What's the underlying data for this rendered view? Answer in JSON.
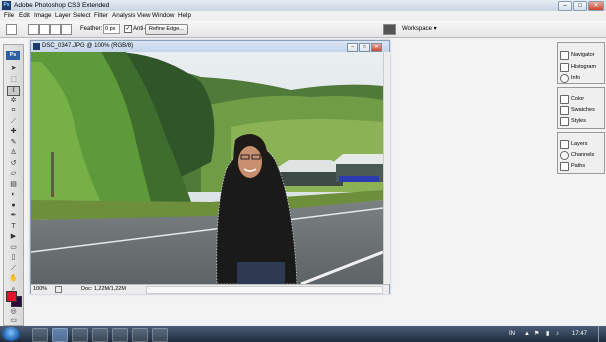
{
  "app": {
    "title": "Adobe Photoshop CS3 Extended",
    "logo_text": "Ps",
    "window_buttons": [
      "–",
      "□",
      "✕"
    ]
  },
  "menu": [
    "File",
    "Edit",
    "Image",
    "Layer",
    "Select",
    "Filter",
    "Analysis",
    "View",
    "Window",
    "Help"
  ],
  "options_bar": {
    "feather_label": "Feather:",
    "feather_value": "0 px",
    "antialias_label": "Anti-alias",
    "refine_edge_label": "Refine Edge...",
    "workspace_label": "Workspace ▾"
  },
  "toolbox": {
    "badge": "Ps",
    "tools": [
      {
        "name": "move-tool-icon",
        "glyph": "➤"
      },
      {
        "name": "marquee-tool-icon",
        "glyph": "⬚"
      },
      {
        "name": "lasso-tool-icon",
        "glyph": "ℓ",
        "selected": true
      },
      {
        "name": "magic-wand-icon",
        "glyph": "✲"
      },
      {
        "name": "crop-tool-icon",
        "glyph": "⌗"
      },
      {
        "name": "slice-tool-icon",
        "glyph": "⟋"
      },
      {
        "name": "healing-brush-icon",
        "glyph": "✚"
      },
      {
        "name": "brush-tool-icon",
        "glyph": "✎"
      },
      {
        "name": "clone-stamp-icon",
        "glyph": "♙"
      },
      {
        "name": "history-brush-icon",
        "glyph": "↺"
      },
      {
        "name": "eraser-tool-icon",
        "glyph": "▱"
      },
      {
        "name": "gradient-tool-icon",
        "glyph": "▤"
      },
      {
        "name": "blur-tool-icon",
        "glyph": "◐"
      },
      {
        "name": "dodge-tool-icon",
        "glyph": "●"
      },
      {
        "name": "pen-tool-icon",
        "glyph": "✒"
      },
      {
        "name": "type-tool-icon",
        "glyph": "T"
      },
      {
        "name": "path-select-icon",
        "glyph": "▶"
      },
      {
        "name": "shape-tool-icon",
        "glyph": "▭"
      },
      {
        "name": "notes-tool-icon",
        "glyph": "▯"
      },
      {
        "name": "eyedropper-icon",
        "glyph": "⟋"
      },
      {
        "name": "hand-tool-icon",
        "glyph": "✋"
      },
      {
        "name": "zoom-tool-icon",
        "glyph": "⌕"
      }
    ],
    "foreground_color": "#e0142c",
    "background_color": "#2a0a3a"
  },
  "document": {
    "title": "DSC_0347.JPG @ 100% (RGB/8)",
    "zoom": "100%",
    "doc_info": "Doc: 1,22M/1,22M"
  },
  "panels": {
    "group1": [
      "Navigator",
      "Histogram",
      "Info"
    ],
    "group2": [
      "Color",
      "Swatches",
      "Styles"
    ],
    "group3": [
      "Layers",
      "Channels",
      "Paths"
    ]
  },
  "taskbar": {
    "language": "IN",
    "clock": "17:47"
  }
}
